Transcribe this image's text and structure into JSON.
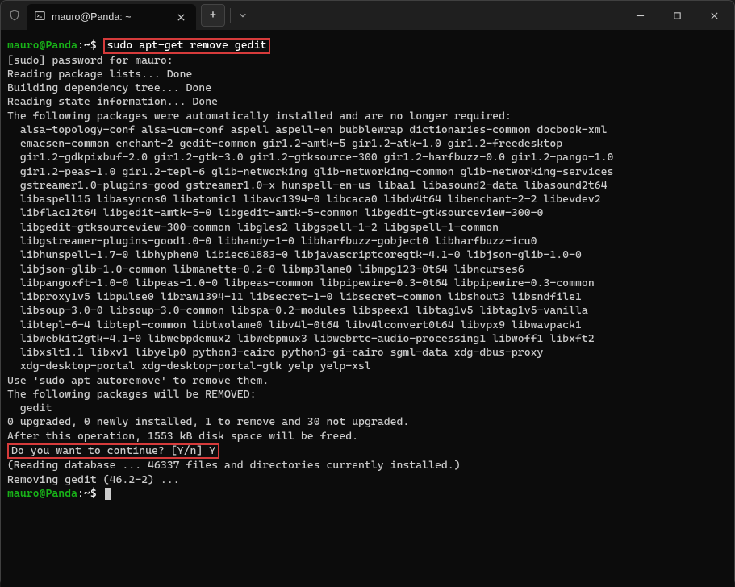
{
  "window": {
    "tab_title": "mauro@Panda: ~"
  },
  "prompt1": {
    "user_host": "mauro@Panda",
    "path": ":~$ ",
    "command": "sudo apt-get remove gedit"
  },
  "lines": {
    "sudo_pw": "[sudo] password for mauro:",
    "reading_pkg": "Reading package lists... Done",
    "building_dep": "Building dependency tree... Done",
    "reading_state": "Reading state information... Done",
    "auto_installed": "The following packages were automatically installed and are no longer required:",
    "pkgs1": "alsa-topology-conf alsa-ucm-conf aspell aspell-en bubblewrap dictionaries-common docbook-xml",
    "pkgs2": "emacsen-common enchant-2 gedit-common gir1.2-amtk-5 gir1.2-atk-1.0 gir1.2-freedesktop",
    "pkgs3": "gir1.2-gdkpixbuf-2.0 gir1.2-gtk-3.0 gir1.2-gtksource-300 gir1.2-harfbuzz-0.0 gir1.2-pango-1.0",
    "pkgs4": "gir1.2-peas-1.0 gir1.2-tepl-6 glib-networking glib-networking-common glib-networking-services",
    "pkgs5": "gstreamer1.0-plugins-good gstreamer1.0-x hunspell-en-us libaa1 libasound2-data libasound2t64",
    "pkgs6": "libaspell15 libasyncns0 libatomic1 libavc1394-0 libcaca0 libdv4t64 libenchant-2-2 libevdev2",
    "pkgs7": "libflac12t64 libgedit-amtk-5-0 libgedit-amtk-5-common libgedit-gtksourceview-300-0",
    "pkgs8": "libgedit-gtksourceview-300-common libgles2 libgspell-1-2 libgspell-1-common",
    "pkgs9": "libgstreamer-plugins-good1.0-0 libhandy-1-0 libharfbuzz-gobject0 libharfbuzz-icu0",
    "pkgs10": "libhunspell-1.7-0 libhyphen0 libiec61883-0 libjavascriptcoregtk-4.1-0 libjson-glib-1.0-0",
    "pkgs11": "libjson-glib-1.0-common libmanette-0.2-0 libmp3lame0 libmpg123-0t64 libncurses6",
    "pkgs12": "libpangoxft-1.0-0 libpeas-1.0-0 libpeas-common libpipewire-0.3-0t64 libpipewire-0.3-common",
    "pkgs13": "libproxy1v5 libpulse0 libraw1394-11 libsecret-1-0 libsecret-common libshout3 libsndfile1",
    "pkgs14": "libsoup-3.0-0 libsoup-3.0-common libspa-0.2-modules libspeex1 libtag1v5 libtag1v5-vanilla",
    "pkgs15": "libtepl-6-4 libtepl-common libtwolame0 libv4l-0t64 libv4lconvert0t64 libvpx9 libwavpack1",
    "pkgs16": "libwebkit2gtk-4.1-0 libwebpdemux2 libwebpmux3 libwebrtc-audio-processing1 libwoff1 libxft2",
    "pkgs17": "libxslt1.1 libxv1 libyelp0 python3-cairo python3-gi-cairo sgml-data xdg-dbus-proxy",
    "pkgs18": "xdg-desktop-portal xdg-desktop-portal-gtk yelp yelp-xsl",
    "use_autoremove": "Use 'sudo apt autoremove' to remove them.",
    "will_remove": "The following packages will be REMOVED:",
    "gedit": "gedit",
    "upgrade_summary": "0 upgraded, 0 newly installed, 1 to remove and 30 not upgraded.",
    "after_op": "After this operation, 1553 kB disk space will be freed.",
    "continue_q": "Do you want to continue? [Y/n] Y",
    "reading_db": "(Reading database ... 46337 files and directories currently installed.)",
    "removing": "Removing gedit (46.2-2) ..."
  },
  "prompt2": {
    "user_host": "mauro@Panda",
    "path": ":~$ "
  }
}
